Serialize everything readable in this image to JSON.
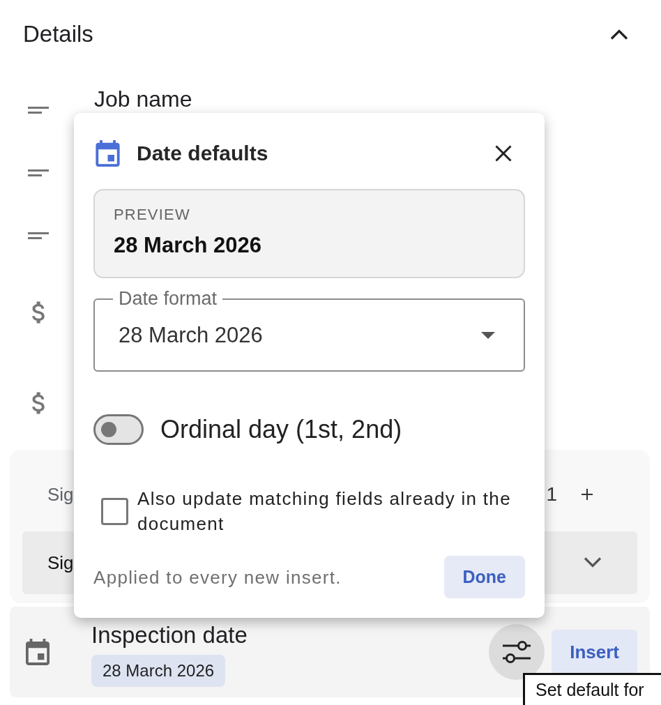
{
  "details": {
    "title": "Details",
    "expanded": true
  },
  "fields": [
    {
      "kind": "text",
      "label": "Job name"
    },
    {
      "kind": "text"
    },
    {
      "kind": "text"
    },
    {
      "kind": "money"
    },
    {
      "kind": "money"
    }
  ],
  "section": {
    "label": "Sig",
    "count": "1",
    "item": {
      "label": "Sig",
      "expanded": false
    }
  },
  "date_field": {
    "label": "Inspection date",
    "value": "28 March 2026",
    "insert_button": "Insert"
  },
  "dialog": {
    "title": "Date defaults",
    "preview": {
      "label": "PREVIEW",
      "value": "28 March 2026"
    },
    "date_format": {
      "label": "Date format",
      "value": "28 March 2026"
    },
    "ordinal_toggle": {
      "label": "Ordinal day (1st, 2nd)",
      "on": false
    },
    "update_existing": {
      "label": "Also update matching fields already in the document",
      "checked": false
    },
    "note": "Applied to every new insert.",
    "done_button": "Done"
  },
  "tooltip": {
    "text": "Set default for"
  }
}
